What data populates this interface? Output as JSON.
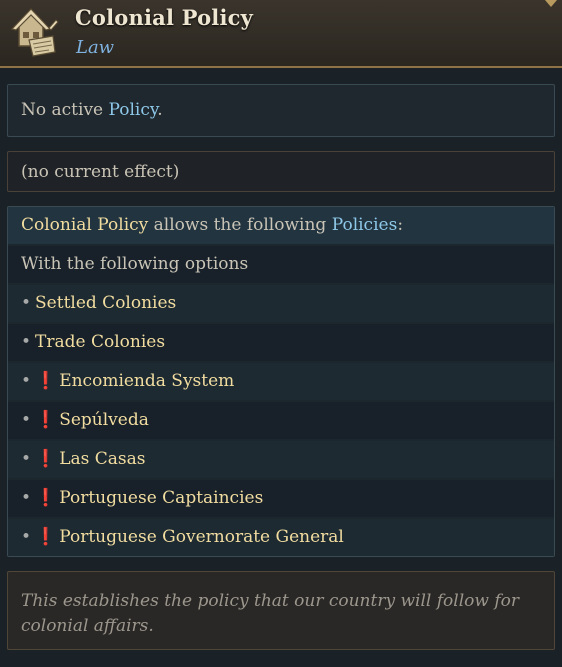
{
  "header": {
    "title": "Colonial Policy",
    "subtitle": "Law",
    "icon": "law-house-scroll-icon"
  },
  "policy_panel": {
    "prefix": "No active ",
    "link": "Policy",
    "suffix": "."
  },
  "effect_panel": {
    "text": "(no current effect)"
  },
  "list_panel": {
    "head_link_1": "Colonial Policy",
    "head_middle": " allows the following ",
    "head_link_2": "Policies",
    "head_suffix": ":",
    "options_label": "With the following options",
    "bullet": "•",
    "warning_mark": "❗",
    "items": [
      {
        "label": "Settled Colonies",
        "warning": false
      },
      {
        "label": "Trade Colonies",
        "warning": false
      },
      {
        "label": "Encomienda System",
        "warning": true
      },
      {
        "label": "Sepúlveda",
        "warning": true
      },
      {
        "label": "Las Casas",
        "warning": true
      },
      {
        "label": "Portuguese Captaincies",
        "warning": true
      },
      {
        "label": "Portuguese Governorate General",
        "warning": true
      }
    ]
  },
  "description": {
    "text": "This establishes the policy that our country will follow for colonial affairs."
  },
  "colors": {
    "accent_blue": "#8ec8e8",
    "gold_text": "#f2dda0",
    "warning_red": "#d22a2a",
    "header_border": "#8d7346"
  }
}
